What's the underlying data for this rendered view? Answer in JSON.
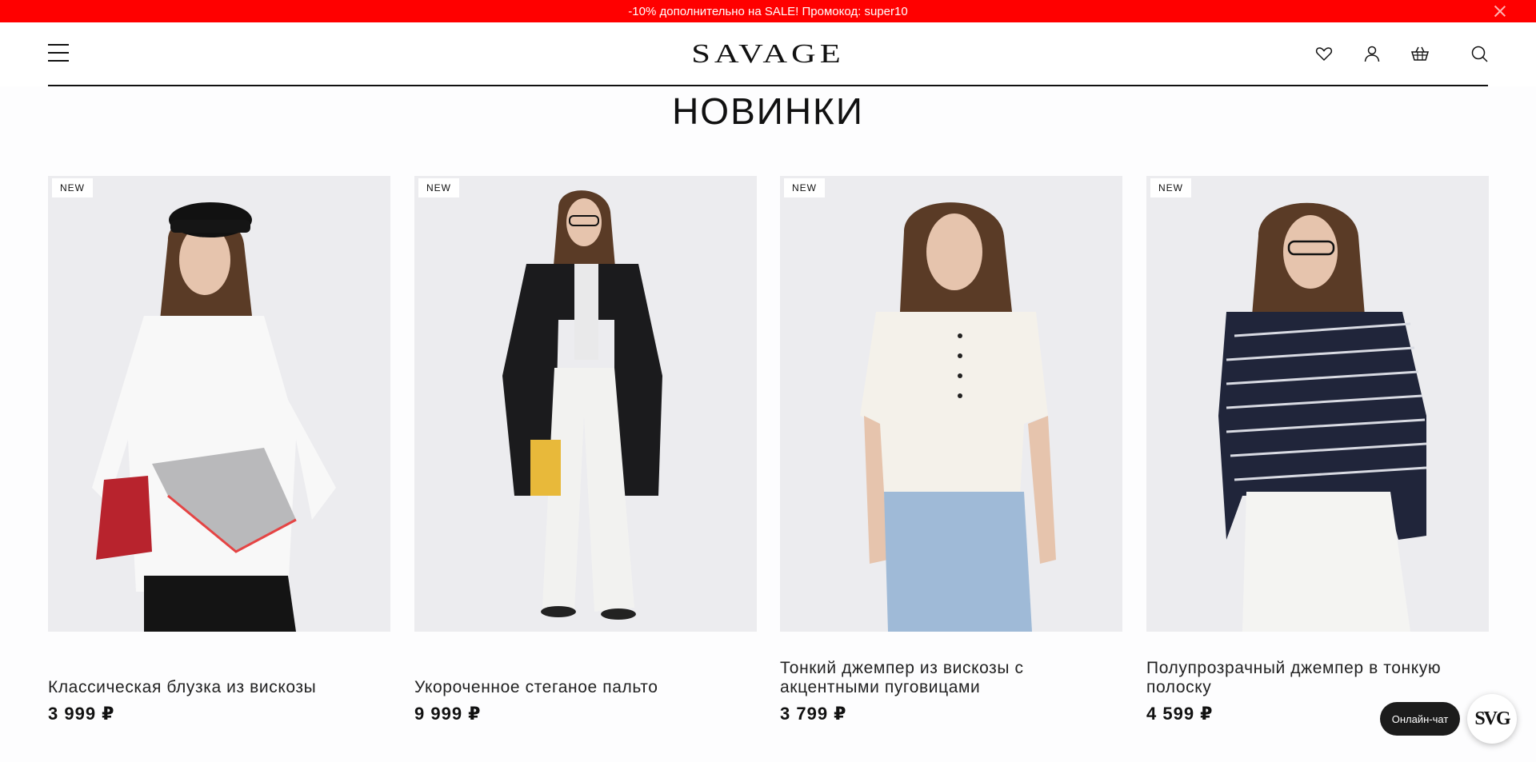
{
  "promo": {
    "text": "-10% дополнительно на SALE! Промокод: super10",
    "close_icon": "close-icon"
  },
  "header": {
    "logo": "SAVAGE",
    "menu_icon": "burger-menu-icon",
    "icons": [
      "heart-icon",
      "user-icon",
      "basket-icon",
      "search-icon"
    ]
  },
  "section": {
    "title": "НОВИНКИ"
  },
  "products": [
    {
      "badge": "NEW",
      "name": "Классическая блузка из вискозы",
      "price": "3 999 ₽"
    },
    {
      "badge": "NEW",
      "name": "Укороченное стеганое пальто",
      "price": "9 999 ₽"
    },
    {
      "badge": "NEW",
      "name": "Тонкий джемпер из вискозы с акцентными пуговицами",
      "price": "3 799 ₽"
    },
    {
      "badge": "NEW",
      "name": "Полупрозрачный джемпер в тонкую полоску",
      "price": "4 599 ₽"
    }
  ],
  "chat": {
    "label": "Онлайн-чат",
    "avatar_text": "SVG"
  },
  "colors": {
    "promo_bg": "#ff0000",
    "text": "#111111",
    "card_bg": "#ececef"
  }
}
